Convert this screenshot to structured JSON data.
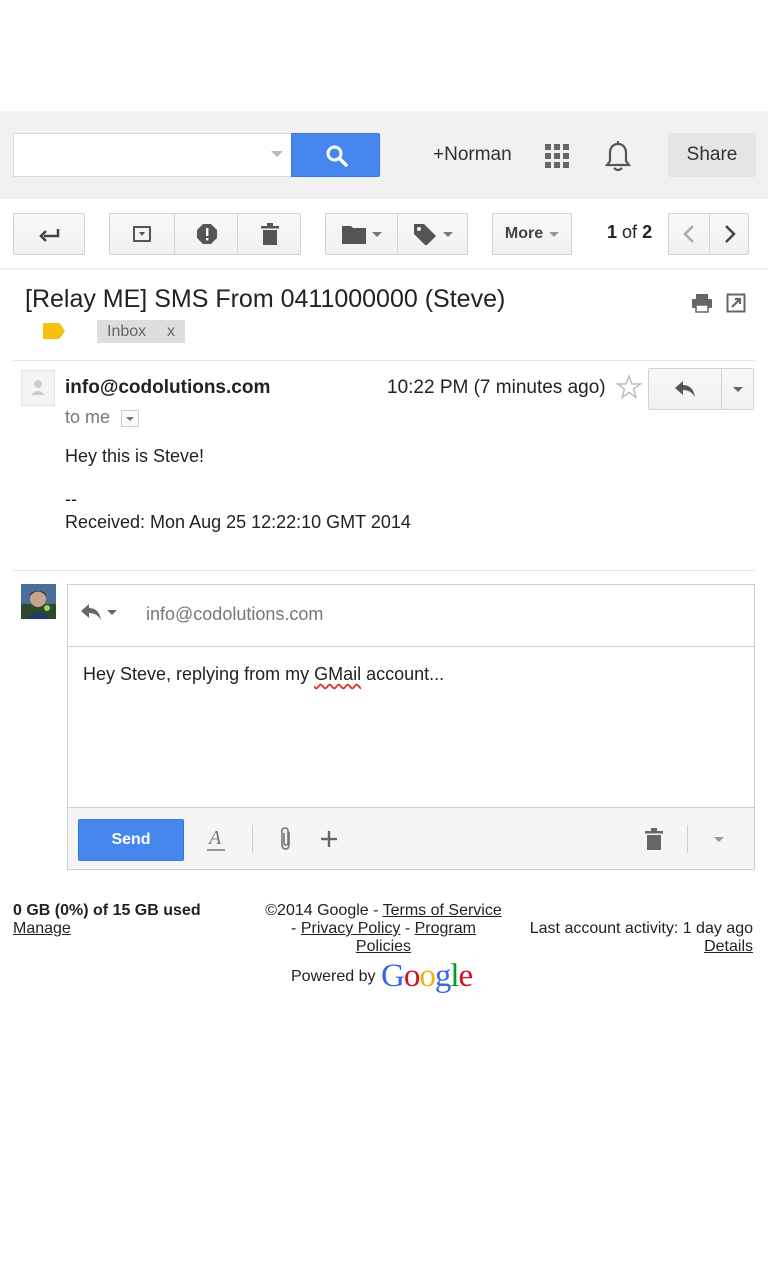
{
  "header": {
    "search": {
      "value": "",
      "placeholder": ""
    },
    "user_name": "+Norman",
    "share_label": "Share"
  },
  "toolbar": {
    "more_label": "More",
    "pager": {
      "current": "1",
      "of_word": "of",
      "total": "2"
    }
  },
  "email": {
    "subject": "[Relay ME] SMS From 0411000000 (Steve)",
    "label_chip": "Inbox",
    "label_chip_close": "x",
    "sender": "info@codolutions.com",
    "time": "10:22 PM (7 minutes ago)",
    "recipient": "to me",
    "body": {
      "line1": "Hey this is Steve!",
      "signature_sep": "--",
      "received": "Received: Mon Aug 25 12:22:10 GMT 2014"
    }
  },
  "compose": {
    "to": "info@codolutions.com",
    "body_before": "Hey Steve, replying from my ",
    "body_misspelled": "GMail",
    "body_after": " account...",
    "send_label": "Send"
  },
  "footer": {
    "storage": "0 GB (0%) of 15 GB used",
    "manage": "Manage",
    "copyright": "©2014 Google - ",
    "terms": "Terms of Service",
    "dash1": "- ",
    "privacy": "Privacy Policy",
    "dash2": " - ",
    "program_policies_1": "Program",
    "program_policies_2": "Policies",
    "last_activity": "Last account activity: 1 day ago",
    "details": "Details",
    "powered_by": "Powered by",
    "google_logo": "Google"
  },
  "colors": {
    "accent": "#4787ed",
    "label_yellow": "#f4c20d",
    "spell_error": "#d93025"
  },
  "icons": [
    "search-icon",
    "apps-grid-icon",
    "bell-icon",
    "back-arrow-icon",
    "archive-icon",
    "report-spam-icon",
    "trash-icon",
    "folder-icon",
    "label-icon",
    "chevron-left-icon",
    "chevron-right-icon",
    "print-icon",
    "new-window-icon",
    "star-icon",
    "reply-icon",
    "paperclip-icon",
    "plus-icon",
    "text-format-icon"
  ]
}
